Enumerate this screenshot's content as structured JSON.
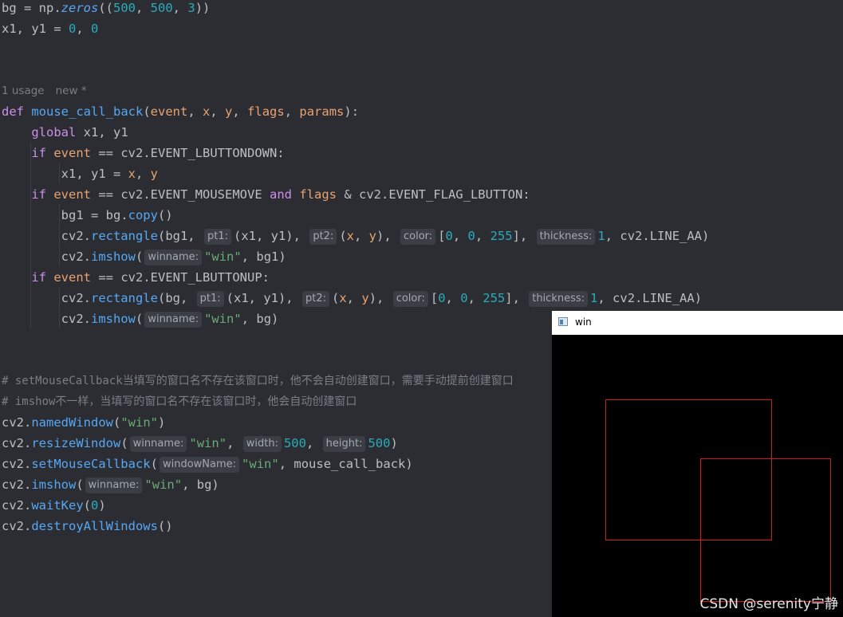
{
  "code": {
    "usage_label": "1 usage",
    "new_label": "new *",
    "comment1": "# setMouseCallback当填写的窗口名不存在该窗口时，他不会自动创建窗口，需要手动提前创建窗口",
    "comment2": "# imshow不一样，当填写的窗口名不存在该窗口时，他会自动创建窗口",
    "hints": {
      "pt1": "pt1:",
      "pt2": "pt2:",
      "color": "color:",
      "thickness": "thickness:",
      "winname": "winname:",
      "width": "width:",
      "height": "height:",
      "windowName": "windowName:"
    },
    "win_str": "\"win\""
  },
  "cv_window": {
    "title": "win",
    "rect_color": "#d11a1a",
    "background": "#000000"
  },
  "watermark": "CSDN @serenity宁静"
}
